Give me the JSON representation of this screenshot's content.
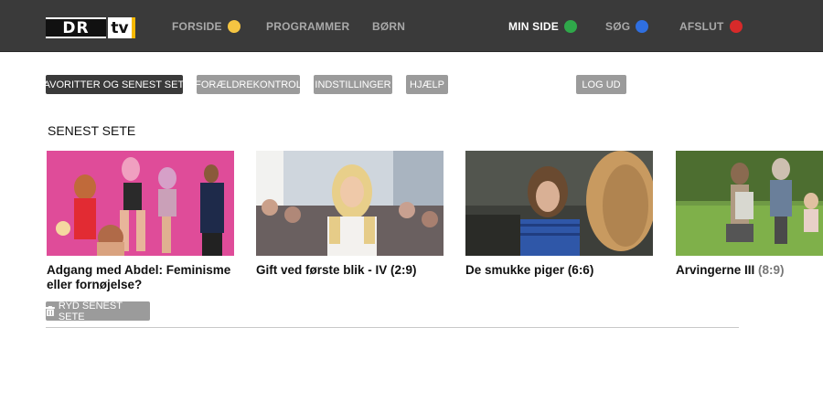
{
  "logo": {
    "dr": "DR",
    "tv": "tv"
  },
  "nav": [
    {
      "label": "FORSIDE",
      "dot_color": "#f5c542",
      "active": false
    },
    {
      "label": "PROGRAMMER",
      "dot_color": "",
      "active": false
    },
    {
      "label": "BØRN",
      "dot_color": "",
      "active": false
    },
    {
      "label": "MIN SIDE",
      "dot_color": "#2fa84a",
      "active": true
    },
    {
      "label": "SØG",
      "dot_color": "#2f6fe0",
      "active": false
    },
    {
      "label": "AFSLUT",
      "dot_color": "#d72a2a",
      "active": false
    }
  ],
  "subnav": {
    "favorites": "FAVORITTER OG SENEST SETE",
    "parental": "FORÆLDREKONTROL",
    "settings": "INDSTILLINGER",
    "help": "HJÆLP",
    "logout": "LOG UD"
  },
  "section_title": "SENEST SETE",
  "cards": [
    {
      "title": "Adgang med Abdel: Feminisme eller fornøjelse?",
      "episode": ""
    },
    {
      "title": "Gift ved første blik - IV",
      "episode": "(2:9)"
    },
    {
      "title": "De smukke piger",
      "episode": "(6:6)"
    },
    {
      "title": "Arvingerne III",
      "episode": "(8:9)"
    }
  ],
  "clear_label": "RYD SENEST SETE",
  "colors": {
    "topbar": "#3a3a3a",
    "button": "#9b9b9b",
    "button_active": "#3a3a3a"
  }
}
